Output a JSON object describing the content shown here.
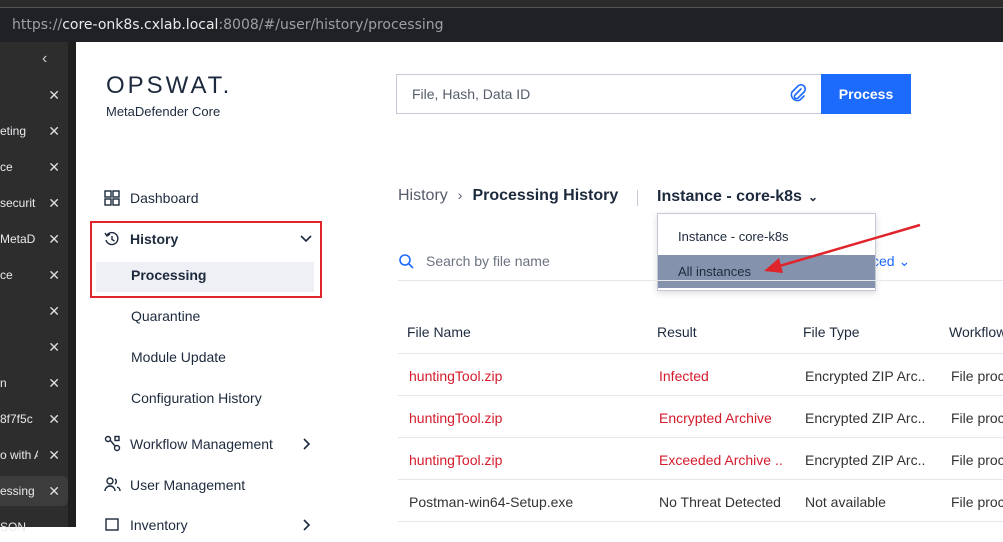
{
  "browser": {
    "url_prefix": "https://",
    "url_host": "core-onk8s.cxlab.local",
    "url_rest": ":8008/#/user/history/processing",
    "tabs": [
      "eting",
      "ce",
      "securit",
      "MetaD",
      "ce",
      "",
      "",
      "n",
      "8f7f5c",
      "o with A",
      "essing",
      "SON"
    ],
    "close_glyph": "✕",
    "collapse_glyph": "‹"
  },
  "logo": {
    "brand": "OPSWAT.",
    "product": "MetaDefender Core"
  },
  "search": {
    "placeholder": "File, Hash, Data ID",
    "button": "Process"
  },
  "nav": {
    "dashboard": "Dashboard",
    "history": "History",
    "sub": [
      "Processing",
      "Quarantine",
      "Module Update",
      "Configuration History"
    ],
    "workflow": "Workflow Management",
    "users": "User Management",
    "inventory": "Inventory"
  },
  "breadcrumb": {
    "parent": "History",
    "current": "Processing History"
  },
  "instance": {
    "selected": "Instance - core-k8s",
    "options": [
      "Instance - core-k8s",
      "All instances"
    ]
  },
  "filter": {
    "placeholder": "Search by file name",
    "advanced": "ced"
  },
  "table": {
    "headers": [
      "File Name",
      "Result",
      "File Type",
      "Workflow"
    ],
    "rows": [
      {
        "name": "huntingTool.zip",
        "result": "Infected",
        "type": "Encrypted ZIP Arc...",
        "workflow": "File proc"
      },
      {
        "name": "huntingTool.zip",
        "result": "Encrypted Archive",
        "type": "Encrypted ZIP Arc...",
        "workflow": "File proc"
      },
      {
        "name": "huntingTool.zip",
        "result": "Exceeded Archive ...",
        "type": "Encrypted ZIP Arc...",
        "workflow": "File proc"
      },
      {
        "name": "Postman-win64-Setup.exe",
        "result": "No Threat Detected",
        "type": "Not available",
        "workflow": "File proc"
      }
    ]
  },
  "colors": {
    "accent": "#1d6bfc",
    "danger": "#d41b2c",
    "highlight": "#e0242b"
  }
}
